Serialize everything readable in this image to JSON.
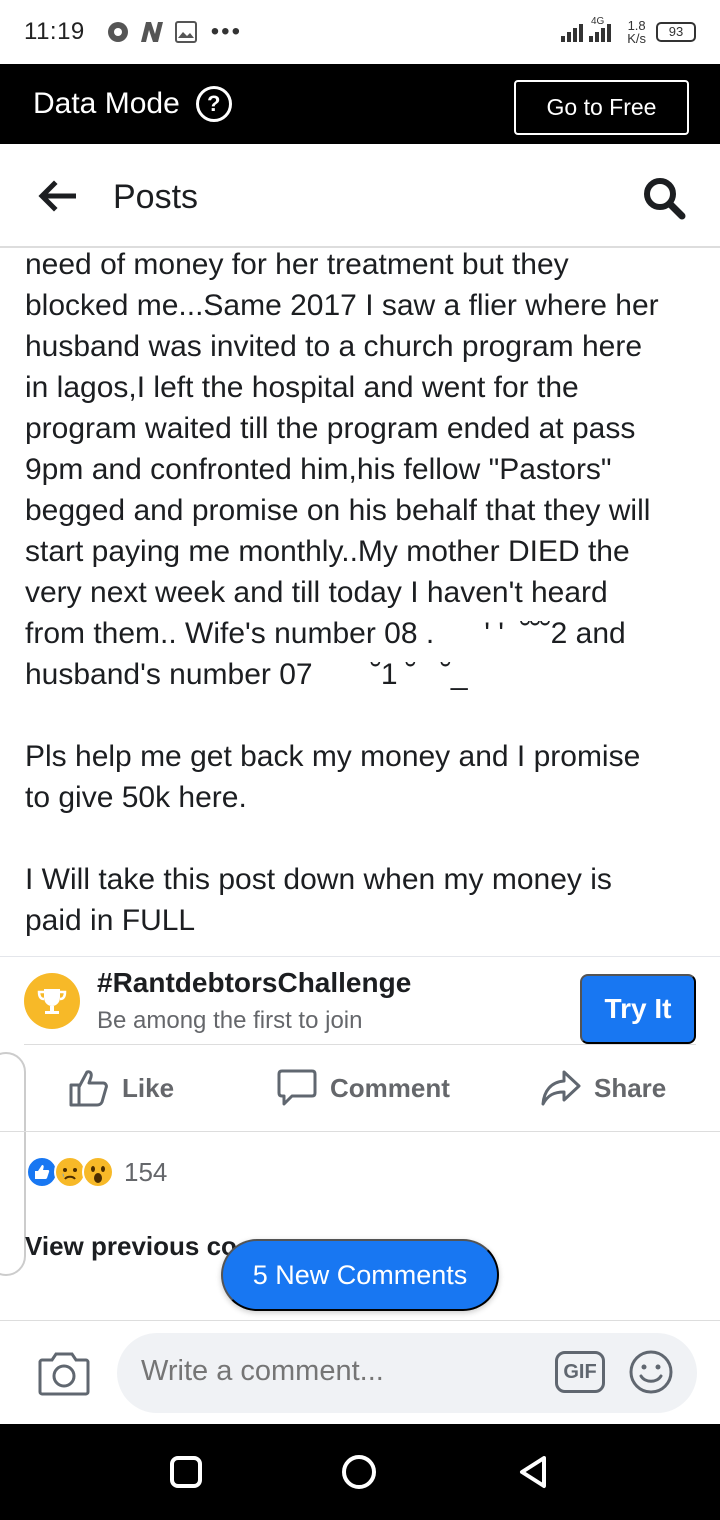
{
  "status_bar": {
    "time": "11:19",
    "dots": "•••",
    "net_speed_value": "1.8",
    "net_speed_unit": "K/s",
    "network": "4G",
    "battery": "93"
  },
  "data_mode": {
    "title": "Data Mode",
    "help": "?",
    "free_button": "Go to Free"
  },
  "header": {
    "title": "Posts"
  },
  "post": {
    "lines": [
      "need of money for her treatment but they",
      "blocked me...Same 2017 I saw a flier where her",
      "husband was invited to a church program here",
      "in lagos,I left the hospital and went for the",
      "program waited till the program ended at pass",
      "9pm and confronted him,his fellow \"Pastors\"",
      "begged and promise on his behalf that they will",
      "start paying me monthly..My mother DIED the",
      "very next week and till today I haven't heard",
      "from them.. Wife's number 08 .      ' '  ˘˘˘2 and",
      "husband's number 07       ˘1 ˘   ˘_",
      "",
      "Pls help me get back my money and I promise",
      "to give 50k here.",
      "",
      "I Will take this post down when my money is",
      "paid in FULL"
    ]
  },
  "challenge": {
    "title": "#RantdebtorsChallenge",
    "subtitle": "Be among the first to join",
    "button": "Try It"
  },
  "actions": {
    "like": "Like",
    "comment": "Comment",
    "share": "Share"
  },
  "reactions": {
    "count": "154"
  },
  "comments": {
    "view_previous": "View previous co",
    "new_comments": "5 New Comments"
  },
  "composer": {
    "placeholder": "Write a comment...",
    "gif": "GIF"
  },
  "colors": {
    "accent": "#1877f2",
    "challenge_icon": "#f7b928"
  }
}
